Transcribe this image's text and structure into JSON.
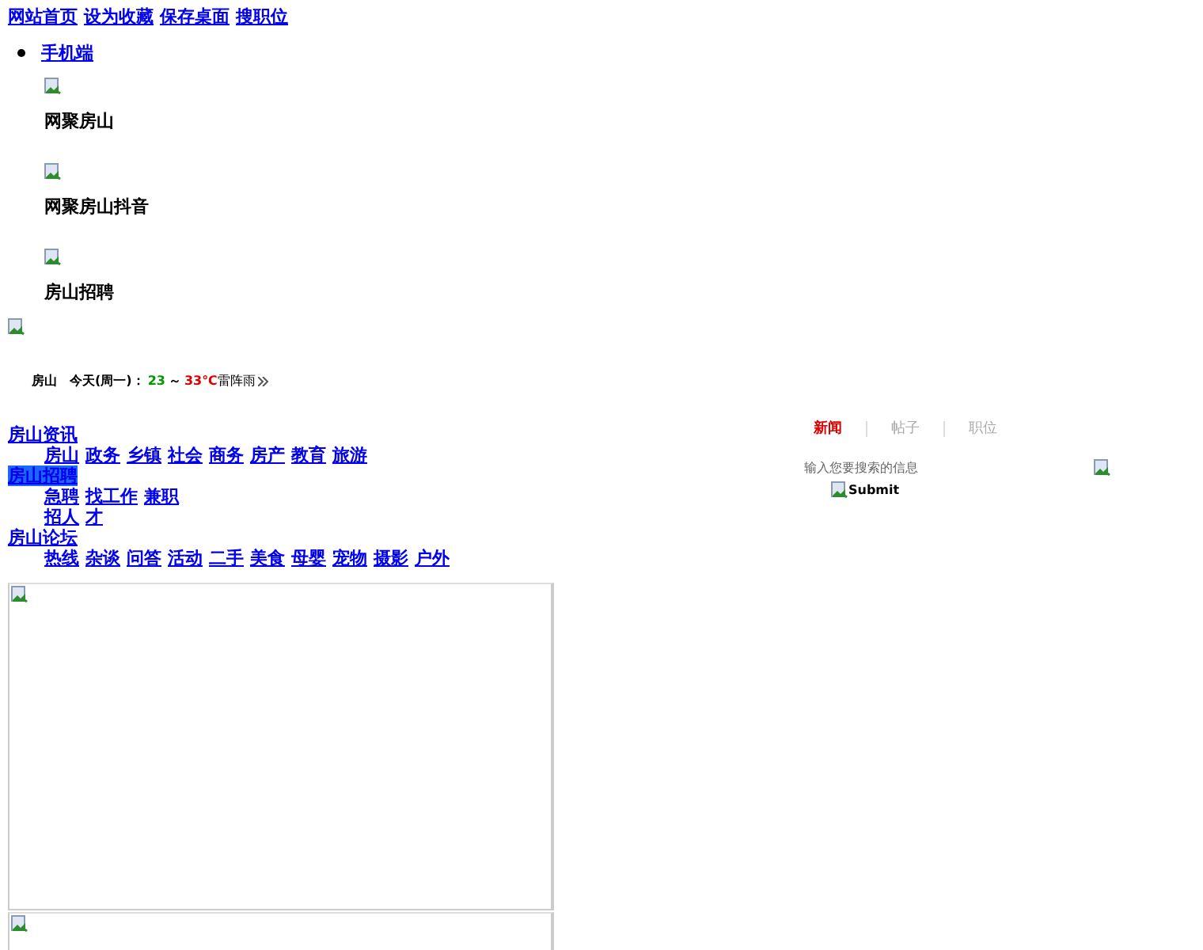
{
  "top_links": [
    "网站首页",
    "设为收藏",
    "保存桌面",
    "搜职位"
  ],
  "menu": {
    "link": "手机端",
    "items": [
      {
        "label": "网聚房山"
      },
      {
        "label": "网聚房山抖音"
      },
      {
        "label": "房山招聘"
      }
    ]
  },
  "weather": {
    "city": "房山",
    "day": "今天(周一)：",
    "low": "23",
    "separator": "～",
    "high": "33℃",
    "condition": "雷阵雨"
  },
  "nav": [
    {
      "title": "房山资讯",
      "selected": false,
      "links": [
        "房山",
        "政务",
        "乡镇",
        "社会",
        "商务",
        "房产",
        "教育",
        "旅游"
      ]
    },
    {
      "title": "房山招聘",
      "selected": true,
      "links": [
        "急聘",
        "找工作",
        "兼职",
        "招人",
        "才"
      ]
    },
    {
      "title": "房山论坛",
      "selected": false,
      "links": [
        "热线",
        "杂谈",
        "问答",
        "活动",
        "二手",
        "美食",
        "母婴",
        "宠物",
        "摄影",
        "户外"
      ]
    }
  ],
  "search": {
    "tabs": [
      {
        "label": "新闻",
        "selected": true
      },
      {
        "label": "帖子",
        "selected": false
      },
      {
        "label": "职位",
        "selected": false
      }
    ],
    "placeholder": "输入您要搜索的信息",
    "submit": "Submit"
  },
  "frames": [
    {
      "kind": "broken-image"
    },
    {
      "kind": "broken-image"
    }
  ]
}
